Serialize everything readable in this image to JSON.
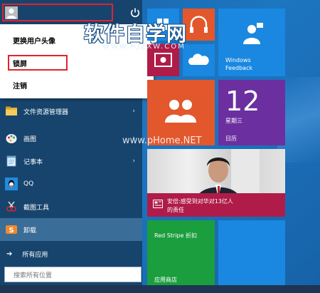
{
  "user_menu": {
    "items": [
      "更换用户头像",
      "锁屏",
      "注销"
    ]
  },
  "apps": [
    {
      "label": "文件资源管理器",
      "icon": "folder-icon",
      "has_arrow": true
    },
    {
      "label": "画图",
      "icon": "paint-icon",
      "has_arrow": true
    },
    {
      "label": "记事本",
      "icon": "notepad-icon",
      "has_arrow": true
    },
    {
      "label": "QQ",
      "icon": "qq-icon",
      "has_arrow": false
    },
    {
      "label": "截图工具",
      "icon": "snipping-tool-icon",
      "has_arrow": false
    },
    {
      "label": "卸载",
      "icon": "uninstall-icon",
      "has_arrow": false
    }
  ],
  "all_apps_label": "所有应用",
  "search_placeholder": "搜索所有位置",
  "tiles": {
    "feedback_line1": "Windows",
    "feedback_line2": "Feedback",
    "calendar_day": "12",
    "calendar_weekday": "星期三",
    "calendar_label": "日历",
    "news_headline_line1": "安倍:感受到对华对13亿人",
    "news_headline_line2": "的责任",
    "store_promo": "Red Stripe 折扣",
    "store_label": "应用商店"
  },
  "watermarks": {
    "site_title": "软件自学网",
    "site_url": "WWW.RJZXW.COM",
    "overlay_url": "www.pHome.NET"
  },
  "colors": {
    "highlight_border": "#e0242b",
    "start_background": "#17446d",
    "tile_blue": "#1a88e0",
    "tile_orange": "#e2572b",
    "tile_purple": "#6b2fa0",
    "tile_green": "#1b9e3e",
    "tile_crimson": "#b01c4a"
  }
}
